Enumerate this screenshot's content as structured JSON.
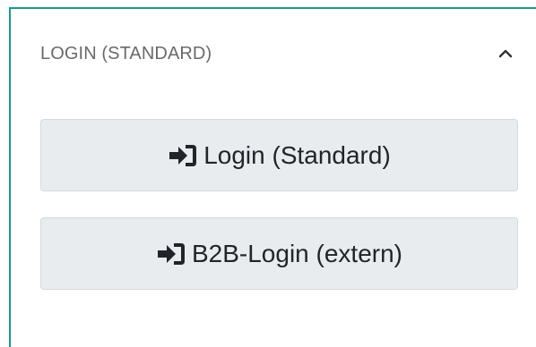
{
  "panel": {
    "title": "LOGIN (STANDARD)",
    "collapse_icon": "chevron-up-icon",
    "accent_color": "#1a9a8a"
  },
  "buttons": [
    {
      "label": "Login (Standard)",
      "icon": "sign-in-icon"
    },
    {
      "label": "B2B-Login (extern)",
      "icon": "sign-in-icon"
    }
  ]
}
